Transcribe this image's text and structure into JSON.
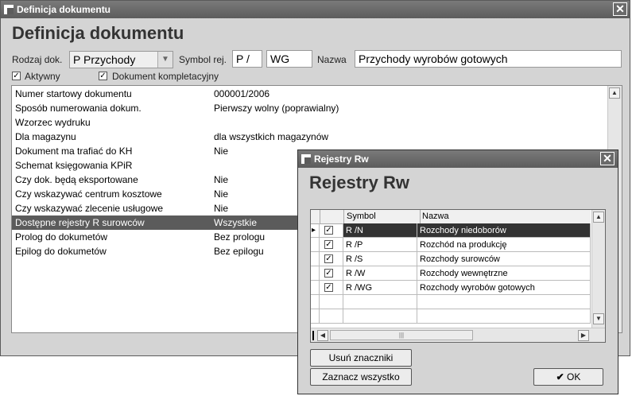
{
  "main_window": {
    "title": "Definicja dokumentu",
    "heading": "Definicja dokumentu",
    "rodzaj_label": "Rodzaj dok.",
    "rodzaj_value": "P Przychody",
    "symbol_label": "Symbol rej.",
    "symbol_prefix": "P /",
    "symbol_value": "WG",
    "nazwa_label": "Nazwa",
    "nazwa_value": "Przychody wyrobów gotowych",
    "aktywny_label": "Aktywny",
    "aktywny_checked": true,
    "kompletacyjny_label": "Dokument kompletacyjny",
    "kompletacyjny_checked": true,
    "properties": [
      {
        "key": "Numer startowy dokumentu",
        "value": "000001/2006"
      },
      {
        "key": "Sposób numerowania dokum.",
        "value": "Pierwszy wolny  (poprawialny)"
      },
      {
        "key": "Wzorzec wydruku",
        "value": ""
      },
      {
        "key": "Dla magazynu",
        "value": "dla wszystkich magazynów"
      },
      {
        "key": "Dokument ma trafiać do KH",
        "value": "Nie"
      },
      {
        "key": "Schemat księgowania KPiR",
        "value": ""
      },
      {
        "key": "Czy dok. będą eksportowane",
        "value": "Nie"
      },
      {
        "key": "Czy wskazywać centrum kosztowe",
        "value": "Nie"
      },
      {
        "key": "Czy wskazywać zlecenie usługowe",
        "value": "Nie"
      },
      {
        "key": "Dostępne rejestry R surowców",
        "value": "Wszystkie"
      },
      {
        "key": "Prolog do dokumetów",
        "value": "Bez prologu"
      },
      {
        "key": "Epilog do dokumetów",
        "value": "Bez epilogu"
      }
    ]
  },
  "dialog": {
    "title": "Rejestry Rw",
    "heading": "Rejestry Rw",
    "columns": [
      "Symbol",
      "Nazwa"
    ],
    "rows": [
      {
        "checked": true,
        "symbol": "R /N",
        "name": "Rozchody niedoborów"
      },
      {
        "checked": true,
        "symbol": "R /P",
        "name": "Rozchód na produkcję"
      },
      {
        "checked": true,
        "symbol": "R /S",
        "name": "Rozchody surowców"
      },
      {
        "checked": true,
        "symbol": "R /W",
        "name": "Rozchody wewnętrzne"
      },
      {
        "checked": true,
        "symbol": "R /WG",
        "name": "Rozchody wyrobów gotowych"
      }
    ],
    "scroll_thumb_glyph": "|||",
    "clear_button": "Usuń znaczniki",
    "select_all_button": "Zaznacz wszystko",
    "ok_button": "OK"
  },
  "colors": {
    "titlebar": "#5c5c5c",
    "selection": "#5b5b5b",
    "window_bg": "#d4d4d4"
  }
}
